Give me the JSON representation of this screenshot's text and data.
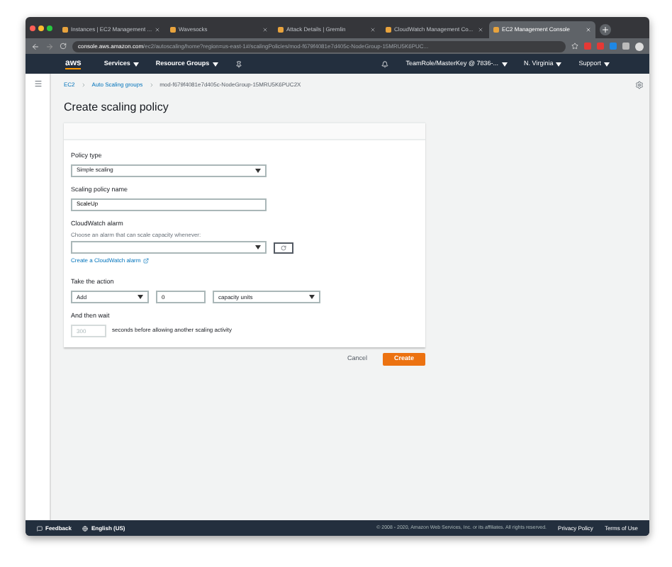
{
  "browser": {
    "tabs": [
      {
        "title": "Instances | EC2 Management ...",
        "selected": false
      },
      {
        "title": "Wavesocks",
        "selected": false
      },
      {
        "title": "Attack Details | Gremlin",
        "selected": false
      },
      {
        "title": "CloudWatch Management Co...",
        "selected": false
      },
      {
        "title": "EC2 Management Console",
        "selected": true
      }
    ],
    "url_host": "console.aws.amazon.com",
    "url_path": "/ec2/autoscaling/home?region=us-east-1#/scalingPolicies/mod-f679f4081e7d405c-NodeGroup-15MRU5K6PUC..."
  },
  "nav": {
    "logo": "aws",
    "menus": [
      "Services",
      "Resource Groups"
    ],
    "account": "TeamRole/MasterKey @ 7836-...",
    "region": "N. Virginia",
    "support": "Support"
  },
  "breadcrumbs": [
    "EC2",
    "Auto Scaling groups",
    "mod-f679f4081e7d405c-NodeGroup-15MRU5K6PUC2X"
  ],
  "title": "Create scaling policy",
  "form": {
    "policy_type": {
      "label": "Policy type",
      "value": "Simple scaling"
    },
    "name": {
      "label": "Scaling policy name",
      "value": "ScaleUp"
    },
    "alarm": {
      "label": "CloudWatch alarm",
      "hint": "Choose an alarm that can scale capacity whenever:",
      "link": "Create a CloudWatch alarm"
    },
    "action": {
      "label": "Take the action",
      "operation": "Add",
      "amount": "0",
      "unit": "capacity units"
    },
    "wait": {
      "label": "And then wait",
      "placeholder": "300",
      "suffix": "seconds before allowing another scaling activity"
    }
  },
  "buttons": {
    "cancel": "Cancel",
    "create": "Create"
  },
  "footer": {
    "feedback": "Feedback",
    "language": "English (US)",
    "copyright": "© 2008 - 2020, Amazon Web Services, Inc. or its affiliates. All rights reserved.",
    "privacy": "Privacy Policy",
    "terms": "Terms of Use"
  }
}
